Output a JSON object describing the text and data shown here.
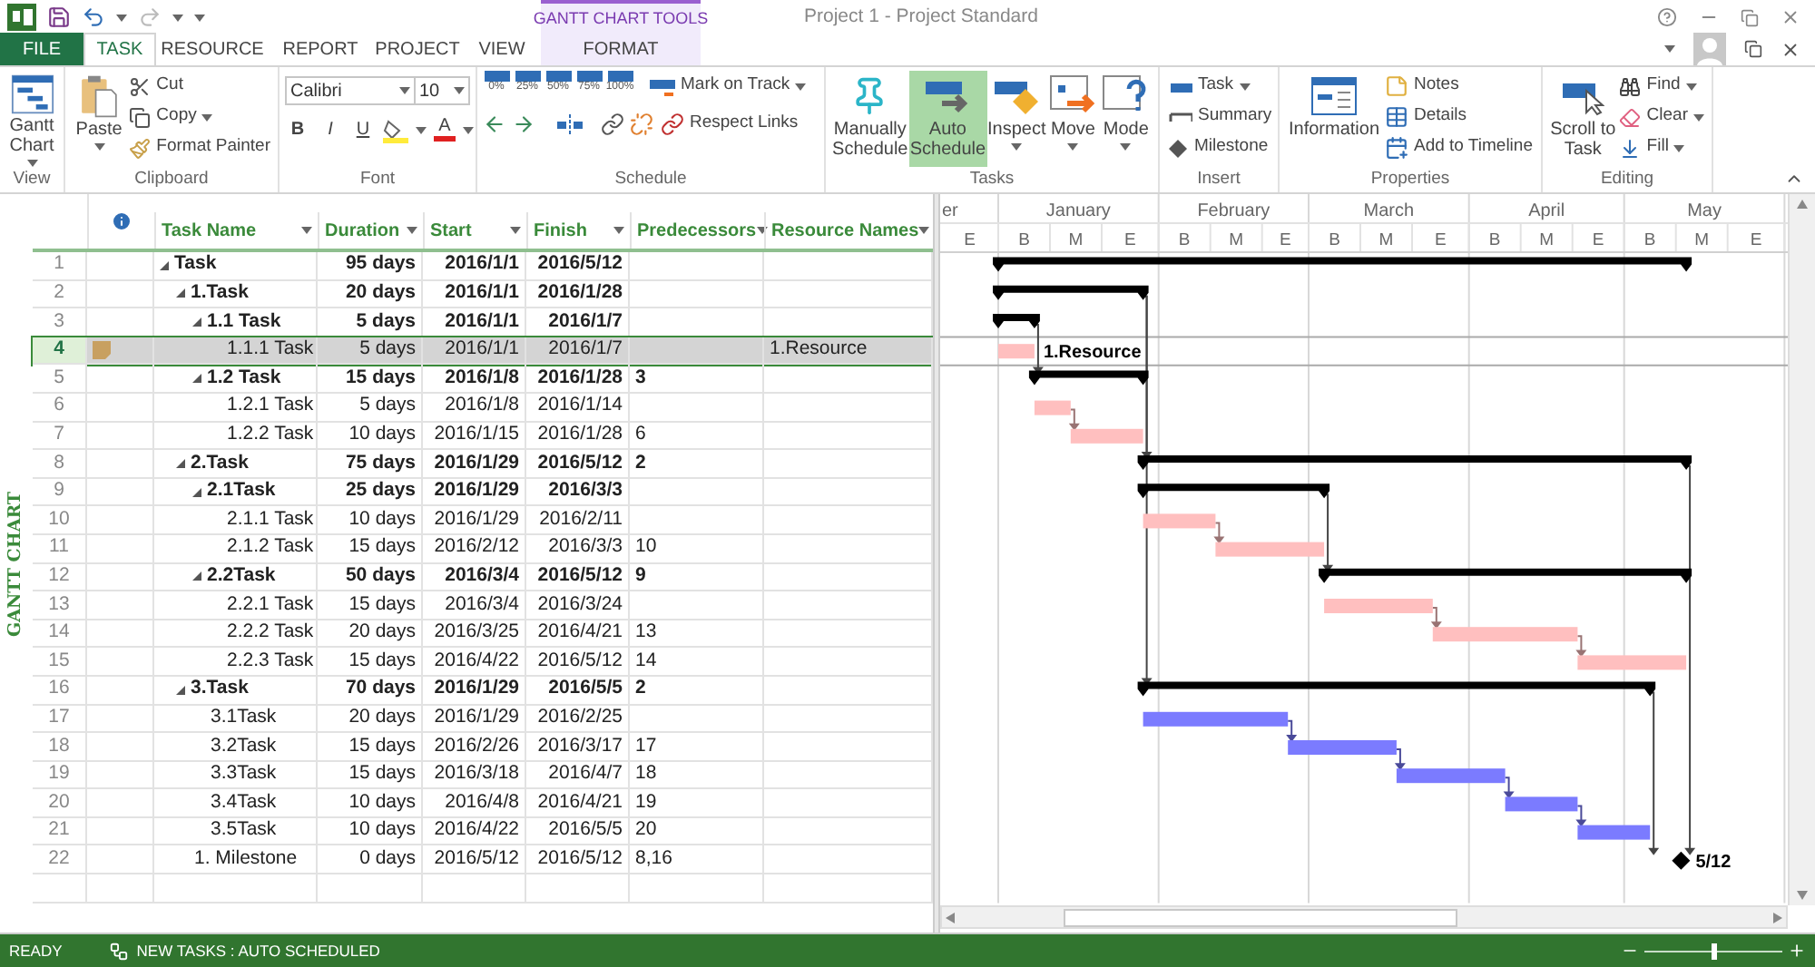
{
  "window": {
    "title": "Project 1 - Project Standard"
  },
  "tabs_context_label": "GANTT CHART TOOLS",
  "tabs": [
    {
      "label": "FILE",
      "kind": "file",
      "selected": false
    },
    {
      "label": "TASK",
      "kind": "tab",
      "selected": true
    },
    {
      "label": "RESOURCE",
      "kind": "tab",
      "selected": false
    },
    {
      "label": "REPORT",
      "kind": "tab",
      "selected": false
    },
    {
      "label": "PROJECT",
      "kind": "tab",
      "selected": false
    },
    {
      "label": "VIEW",
      "kind": "tab",
      "selected": false
    },
    {
      "label": "FORMAT",
      "kind": "contextual",
      "selected": false
    }
  ],
  "ribbon": {
    "groups": [
      {
        "label": "View",
        "items": [
          {
            "label": "Gantt Chart",
            "dropdown": true
          }
        ]
      },
      {
        "label": "Clipboard",
        "items": [
          {
            "label": "Paste",
            "dropdown": true
          },
          {
            "label": "Cut",
            "dropdown": false
          },
          {
            "label": "Copy",
            "dropdown": true
          },
          {
            "label": "Format Painter",
            "dropdown": false
          }
        ]
      },
      {
        "label": "Font",
        "font": "Calibri",
        "size": "10",
        "buttons": [
          "B",
          "I",
          "U"
        ],
        "font_color_label": "A"
      },
      {
        "label": "Schedule",
        "percents": [
          "0%",
          "25%",
          "50%",
          "75%",
          "100%"
        ],
        "items": [
          {
            "label": "Mark on Track",
            "dropdown": true
          },
          {
            "label": "Respect Links",
            "dropdown": false
          }
        ]
      },
      {
        "label": "Tasks",
        "items": [
          {
            "label": "Manually Schedule",
            "dropdown": false,
            "selected": false
          },
          {
            "label": "Auto Schedule",
            "dropdown": false,
            "selected": true
          },
          {
            "label": "Inspect",
            "dropdown": true
          },
          {
            "label": "Move",
            "dropdown": true
          },
          {
            "label": "Mode",
            "dropdown": true
          }
        ]
      },
      {
        "label": "Insert",
        "items": [
          {
            "label": "Task",
            "dropdown": true
          },
          {
            "label": "Summary",
            "dropdown": false
          },
          {
            "label": "Milestone",
            "dropdown": false
          }
        ]
      },
      {
        "label": "Properties",
        "items": [
          {
            "label": "Information",
            "dropdown": false
          },
          {
            "label": "Notes",
            "dropdown": false
          },
          {
            "label": "Details",
            "dropdown": false
          },
          {
            "label": "Add to Timeline",
            "dropdown": false
          }
        ]
      },
      {
        "label": "Editing",
        "items": [
          {
            "label": "Scroll to Task",
            "dropdown": false
          },
          {
            "label": "Find",
            "dropdown": true
          },
          {
            "label": "Clear",
            "dropdown": true
          },
          {
            "label": "Fill",
            "dropdown": true
          }
        ]
      }
    ]
  },
  "view_label": "GANTT CHART",
  "table": {
    "columns": [
      "Task Name",
      "Duration",
      "Start",
      "Finish",
      "Predecessors",
      "Resource Names"
    ]
  },
  "tasks": [
    {
      "id": "1",
      "name": "Task",
      "duration": "95 days",
      "start": "2016/1/1",
      "finish": "2016/5/12",
      "kind": "summary",
      "expanded": true,
      "selected": false,
      "children": [
        {
          "id": "2",
          "name": "1.Task",
          "duration": "20 days",
          "start": "2016/1/1",
          "finish": "2016/1/28",
          "kind": "summary",
          "expanded": true,
          "selected": false,
          "children": [
            {
              "id": "3",
              "name": "1.1 Task",
              "duration": "5 days",
              "start": "2016/1/1",
              "finish": "2016/1/7",
              "kind": "summary",
              "expanded": true,
              "selected": false,
              "children": [
                {
                  "id": "4",
                  "name": "1.1.1 Task",
                  "duration": "5 days",
                  "start": "2016/1/1",
                  "finish": "2016/1/7",
                  "resource": "1.Resource",
                  "kind": "task",
                  "color": "#ffbfbf",
                  "selected": true,
                  "note": true,
                  "bar_label": "1.Resource"
                }
              ]
            },
            {
              "id": "5",
              "name": "1.2 Task",
              "duration": "15 days",
              "start": "2016/1/8",
              "finish": "2016/1/28",
              "predecessors": "3",
              "kind": "summary",
              "expanded": true,
              "selected": false,
              "children": [
                {
                  "id": "6",
                  "name": "1.2.1 Task",
                  "duration": "5 days",
                  "start": "2016/1/8",
                  "finish": "2016/1/14",
                  "kind": "task",
                  "color": "#ffbfbf",
                  "selected": false
                },
                {
                  "id": "7",
                  "name": "1.2.2 Task",
                  "duration": "10 days",
                  "start": "2016/1/15",
                  "finish": "2016/1/28",
                  "predecessors": "6",
                  "kind": "task",
                  "color": "#ffbfbf",
                  "selected": false
                }
              ]
            }
          ]
        },
        {
          "id": "8",
          "name": "2.Task",
          "duration": "75 days",
          "start": "2016/1/29",
          "finish": "2016/5/12",
          "predecessors": "2",
          "kind": "summary",
          "expanded": true,
          "selected": false,
          "children": [
            {
              "id": "9",
              "name": "2.1Task",
              "duration": "25 days",
              "start": "2016/1/29",
              "finish": "2016/3/3",
              "kind": "summary",
              "expanded": true,
              "selected": false,
              "children": [
                {
                  "id": "10",
                  "name": "2.1.1 Task",
                  "duration": "10 days",
                  "start": "2016/1/29",
                  "finish": "2016/2/11",
                  "kind": "task",
                  "color": "#ffbfbf",
                  "selected": false
                },
                {
                  "id": "11",
                  "name": "2.1.2 Task",
                  "duration": "15 days",
                  "start": "2016/2/12",
                  "finish": "2016/3/3",
                  "predecessors": "10",
                  "kind": "task",
                  "color": "#ffbfbf",
                  "selected": false
                }
              ]
            },
            {
              "id": "12",
              "name": "2.2Task",
              "duration": "50 days",
              "start": "2016/3/4",
              "finish": "2016/5/12",
              "predecessors": "9",
              "kind": "summary",
              "expanded": true,
              "selected": false,
              "children": [
                {
                  "id": "13",
                  "name": "2.2.1 Task",
                  "duration": "15 days",
                  "start": "2016/3/4",
                  "finish": "2016/3/24",
                  "kind": "task",
                  "color": "#ffbfbf",
                  "selected": false
                },
                {
                  "id": "14",
                  "name": "2.2.2 Task",
                  "duration": "20 days",
                  "start": "2016/3/25",
                  "finish": "2016/4/21",
                  "predecessors": "13",
                  "kind": "task",
                  "color": "#ffbfbf",
                  "selected": false
                },
                {
                  "id": "15",
                  "name": "2.2.3 Task",
                  "duration": "15 days",
                  "start": "2016/4/22",
                  "finish": "2016/5/12",
                  "predecessors": "14",
                  "kind": "task",
                  "color": "#ffbfbf",
                  "selected": false
                }
              ]
            }
          ]
        },
        {
          "id": "16",
          "name": "3.Task",
          "duration": "70 days",
          "start": "2016/1/29",
          "finish": "2016/5/5",
          "predecessors": "2",
          "kind": "summary",
          "expanded": true,
          "selected": false,
          "children": [
            {
              "id": "17",
              "name": "3.1Task",
              "duration": "20 days",
              "start": "2016/1/29",
              "finish": "2016/2/25",
              "kind": "task",
              "color": "#7b7bff",
              "selected": false
            },
            {
              "id": "18",
              "name": "3.2Task",
              "duration": "15 days",
              "start": "2016/2/26",
              "finish": "2016/3/17",
              "predecessors": "17",
              "kind": "task",
              "color": "#7b7bff",
              "selected": false
            },
            {
              "id": "19",
              "name": "3.3Task",
              "duration": "15 days",
              "start": "2016/3/18",
              "finish": "2016/4/7",
              "predecessors": "18",
              "kind": "task",
              "color": "#7b7bff",
              "selected": false
            },
            {
              "id": "20",
              "name": "3.4Task",
              "duration": "10 days",
              "start": "2016/4/8",
              "finish": "2016/4/21",
              "predecessors": "19",
              "kind": "task",
              "color": "#7b7bff",
              "selected": false
            },
            {
              "id": "21",
              "name": "3.5Task",
              "duration": "10 days",
              "start": "2016/4/22",
              "finish": "2016/5/5",
              "predecessors": "20",
              "kind": "task",
              "color": "#7b7bff",
              "selected": false
            }
          ]
        },
        {
          "id": "22",
          "name": "1. Milestone",
          "duration": "0 days",
          "start": "2016/5/12",
          "finish": "2016/5/12",
          "predecessors": "8,16",
          "kind": "milestone",
          "selected": false,
          "bar_label": "5/12"
        }
      ]
    }
  ],
  "gantt": {
    "months": [
      "er",
      "January",
      "February",
      "March",
      "April",
      "May"
    ],
    "thirds": [
      "E",
      "B",
      "M",
      "E",
      "B",
      "M",
      "E",
      "B",
      "M",
      "E",
      "B",
      "M",
      "E",
      "B",
      "M",
      "E"
    ]
  },
  "status_bar": {
    "ready": "READY",
    "mode": "NEW TASKS : AUTO SCHEDULED",
    "zoom": {
      "level": 0.5
    }
  }
}
